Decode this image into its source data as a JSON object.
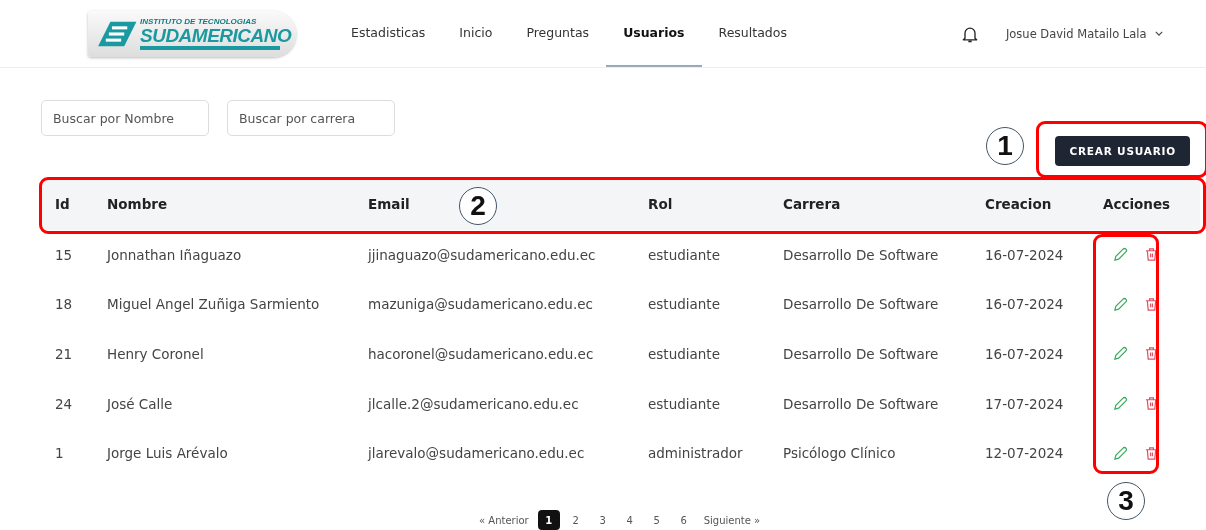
{
  "logo": {
    "line_1": "INSTITUTO DE TECNOLOGIAS",
    "line_2": "SUDAMERICANO"
  },
  "nav": [
    {
      "label": "Estadisticas",
      "selected": false
    },
    {
      "label": "Inicio",
      "selected": false
    },
    {
      "label": "Preguntas",
      "selected": false
    },
    {
      "label": "Usuarios",
      "selected": true
    },
    {
      "label": "Resultados",
      "selected": false
    }
  ],
  "user": {
    "name": "Josue David Matailo Lala"
  },
  "filters": [
    {
      "placeholder": "Buscar por Nombre"
    },
    {
      "placeholder": "Buscar por carrera"
    }
  ],
  "create_button": "CREAR USUARIO",
  "table": {
    "columns": [
      "Id",
      "Nombre",
      "Email",
      "Rol",
      "Carrera",
      "Creacion",
      "Acciones"
    ],
    "rows": [
      {
        "cells": [
          "15",
          "Jonnathan Iñaguazo",
          "jjinaguazo@sudamericano.edu.ec",
          "estudiante",
          "Desarrollo De Software",
          "16-07-2024"
        ]
      },
      {
        "cells": [
          "18",
          "Miguel Angel Zuñiga Sarmiento",
          "mazuniga@sudamericano.edu.ec",
          "estudiante",
          "Desarrollo De Software",
          "16-07-2024"
        ]
      },
      {
        "cells": [
          "21",
          "Henry Coronel",
          "hacoronel@sudamericano.edu.ec",
          "estudiante",
          "Desarrollo De Software",
          "16-07-2024"
        ]
      },
      {
        "cells": [
          "24",
          "José Calle",
          "jlcalle.2@sudamericano.edu.ec",
          "estudiante",
          "Desarrollo De Software",
          "17-07-2024"
        ]
      },
      {
        "cells": [
          "1",
          "Jorge Luis Arévalo",
          "jlarevalo@sudamericano.edu.ec",
          "administrador",
          "Psicólogo Clínico",
          "12-07-2024"
        ]
      }
    ]
  },
  "pagination": {
    "previous": "« Anterior",
    "pages": [
      {
        "label": "1",
        "selected": true
      },
      {
        "label": "2",
        "selected": false
      },
      {
        "label": "3",
        "selected": false
      },
      {
        "label": "4",
        "selected": false
      },
      {
        "label": "5",
        "selected": false
      },
      {
        "label": "6",
        "selected": false
      }
    ],
    "next": "Siguiente »"
  },
  "annotations": [
    "1",
    "2",
    "3"
  ]
}
